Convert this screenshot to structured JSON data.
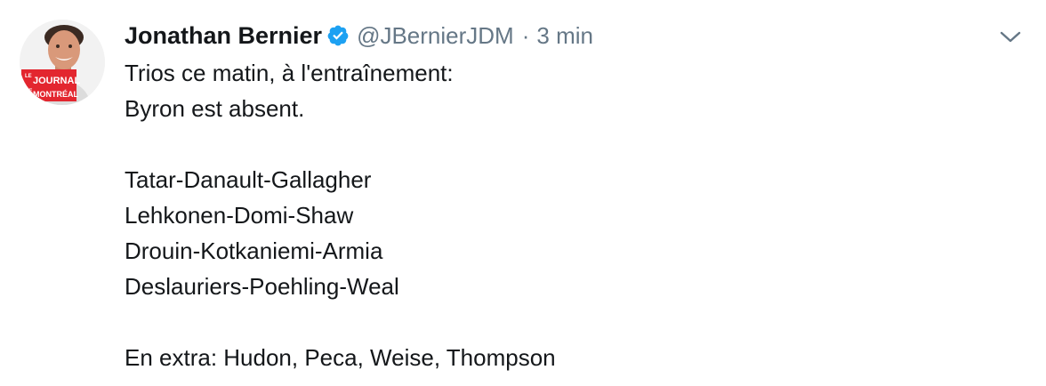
{
  "tweet": {
    "author_name": "Jonathan Bernier",
    "handle": "@JBernierJDM",
    "separator": "·",
    "time": "3 min",
    "avatar_logo": {
      "line1": "LE",
      "line2": "JOURNAL",
      "line3": "DE",
      "line4": "MONTRÉAL"
    },
    "lines": [
      "Trios ce matin, à l'entraînement:",
      "Byron est absent.",
      "",
      "Tatar-Danault-Gallagher",
      "Lehkonen-Domi-Shaw",
      "Drouin-Kotkaniemi-Armia",
      "Deslauriers-Poehling-Weal",
      "",
      "En extra: Hudon, Peca, Weise, Thompson"
    ]
  },
  "icons": {
    "verified": "verified-badge-icon",
    "caret": "chevron-down-icon"
  },
  "colors": {
    "text": "#14171a",
    "secondary": "#657786",
    "verified_blue": "#1da1f2",
    "logo_red": "#e3262f"
  }
}
